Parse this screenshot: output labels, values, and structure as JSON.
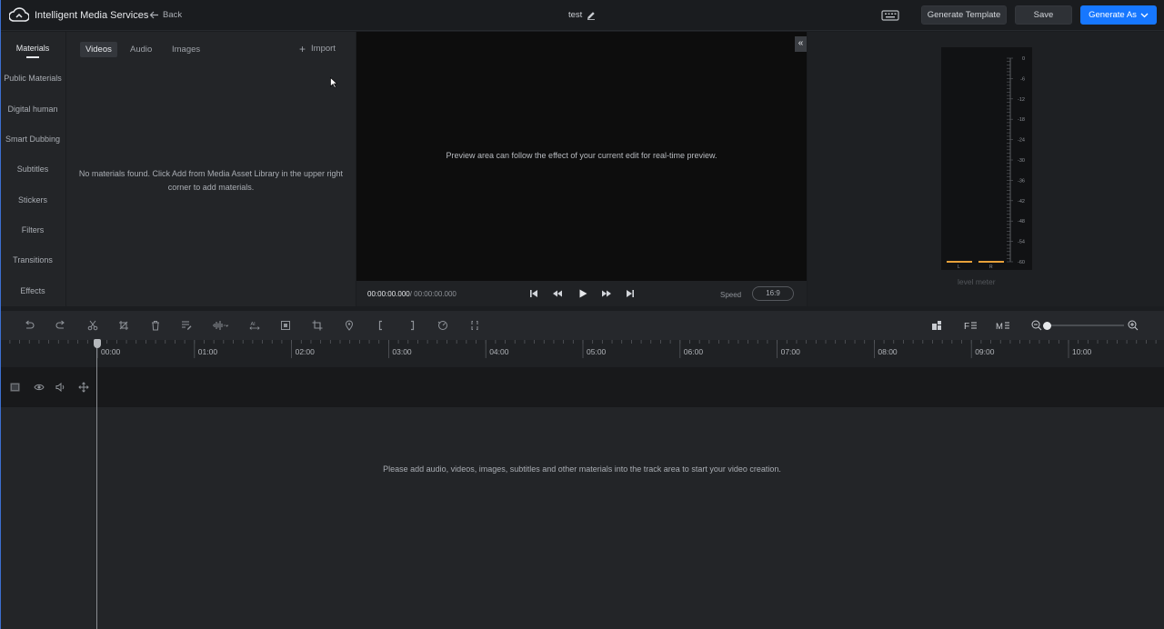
{
  "header": {
    "app_title": "Intelligent Media Services",
    "back_label": "Back",
    "document_title": "test",
    "generate_template_label": "Generate Template",
    "save_label": "Save",
    "generate_as_label": "Generate As"
  },
  "sidebar": {
    "items": [
      {
        "label": "Materials"
      },
      {
        "label": "Public Materials"
      },
      {
        "label": "Digital human"
      },
      {
        "label": "Smart Dubbing"
      },
      {
        "label": "Subtitles"
      },
      {
        "label": "Stickers"
      },
      {
        "label": "Filters"
      },
      {
        "label": "Transitions"
      },
      {
        "label": "Effects"
      }
    ]
  },
  "materials": {
    "tabs": [
      {
        "label": "Videos"
      },
      {
        "label": "Audio"
      },
      {
        "label": "Images"
      }
    ],
    "import_label": "Import",
    "empty_line1": "No materials found. Click Add from Media Asset Library in the upper right",
    "empty_line2": "corner to add materials."
  },
  "preview": {
    "message": "Preview area can follow the effect of your current edit for real-time preview.",
    "current_time": "00:00:00.000",
    "total_time": "/ 00:00:00.000",
    "speed_label": "Speed",
    "aspect_ratio": "16:9"
  },
  "level_meter": {
    "label": "level meter",
    "scale": [
      "0",
      "-6",
      "-12",
      "-18",
      "-24",
      "-30",
      "-36",
      "-42",
      "-48",
      "-54",
      "-60"
    ],
    "channels": [
      "L",
      "R"
    ]
  },
  "timeline": {
    "ruler_labels": [
      "00:00",
      "01:00",
      "02:00",
      "03:00",
      "04:00",
      "05:00",
      "06:00",
      "07:00",
      "08:00",
      "09:00",
      "10:00"
    ],
    "empty_message": "Please add audio, videos, images, subtitles and other materials into the track area to start your video creation."
  },
  "colors": {
    "accent": "#1677ff",
    "meter_level": "#e8a13a"
  }
}
